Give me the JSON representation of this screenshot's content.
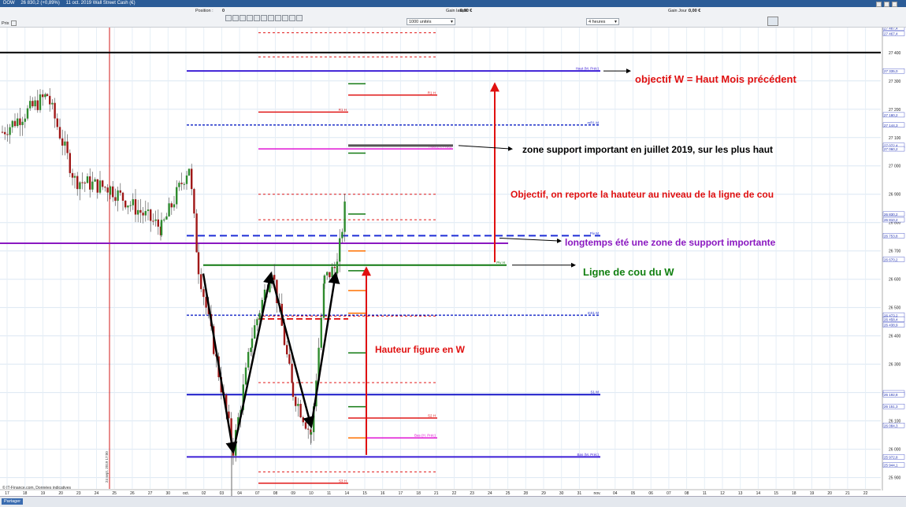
{
  "titlebar": {
    "items": [
      "DOW",
      "26 830,2 (+0,89%)",
      "11 oct. 2019 Wall Street Cash (€)"
    ]
  },
  "toolbar": {
    "position_label": "Position :",
    "position_value": "0",
    "gain_latent_label": "Gain latent :",
    "gain_latent_value": "0,00 €",
    "gain_jour_label": "Gain Jour :",
    "gain_jour_value": "0,00 €",
    "units_select": "1000 unités",
    "interval_select": "4 heures",
    "price_label": "Prix"
  },
  "chart_data": {
    "type": "candlestick",
    "instrument": "DOW - Wall Street Cash (€)",
    "last_price": "26 830,2",
    "change": "+0,89%",
    "x_tick_labels": [
      "17",
      "18",
      "19",
      "20",
      "23",
      "24",
      "25",
      "26",
      "27",
      "30",
      "oct.",
      "02",
      "03",
      "04",
      "07",
      "08",
      "09",
      "10",
      "11",
      "14",
      "15",
      "16",
      "17",
      "18",
      "21",
      "22",
      "23",
      "24",
      "25",
      "28",
      "29",
      "30",
      "31",
      "nov.",
      "04",
      "05",
      "06",
      "07",
      "08",
      "11",
      "12",
      "13",
      "14",
      "15",
      "18",
      "19",
      "20",
      "21",
      "22"
    ],
    "y_tick_labels": [
      "27 400",
      "27 300",
      "27 200",
      "27 100",
      "27 000",
      "26 900",
      "26 800",
      "26 700",
      "26 600",
      "26 500",
      "26 400",
      "26 300",
      "26 200",
      "26 100",
      "26 000",
      "25 900"
    ],
    "y_range": [
      25860,
      27480
    ],
    "price_tags": [
      "27 487,4",
      "27 467,4",
      "27 335,0",
      "27 180,2",
      "27 144,3",
      "27 072,4",
      "27 060,2",
      "26 830,2",
      "26 810,2",
      "26 753,8",
      "26 670,2",
      "26 473,2",
      "26 458,4",
      "26 438,9",
      "26 199,0",
      "26 192,8",
      "26 151,3",
      "26 084,3",
      "25 972,8",
      "25 944,1"
    ],
    "horizontal_lines": [
      {
        "label": "Haut (M. Préc)",
        "value": 27335.0,
        "color": "#3d1fd6",
        "style": "solid"
      },
      {
        "label": "mR1 M",
        "value": 27144.3,
        "color": "#1d2fc9",
        "style": "dotted"
      },
      {
        "label": "Haut (H. Préc)",
        "value": 27060.2,
        "color": "#e016d4",
        "style": "solid"
      },
      {
        "label": "Piv M",
        "value": 26753.8,
        "color": "#1f2fd6",
        "style": "dashed"
      },
      {
        "label": "Piv H",
        "value": 26650.0,
        "color": "#127a12",
        "style": "solid"
      },
      {
        "label": "mS1 M",
        "value": 26473.2,
        "color": "#1d2fc9",
        "style": "dotted"
      },
      {
        "label": "S1 M",
        "value": 26192.8,
        "color": "#1818c8",
        "style": "solid"
      },
      {
        "label": "Bas (M. Préc)",
        "value": 25972.8,
        "color": "#3d1fd6",
        "style": "solid"
      },
      {
        "label": "Bas (H. Préc)",
        "value": 26040.0,
        "color": "#e016d4",
        "style": "solid"
      },
      {
        "label": "R1 H",
        "value": 27190.0,
        "color": "#e01818",
        "style": "solid"
      },
      {
        "label": "R1 H",
        "value": 27250.0,
        "color": "#e01818",
        "style": "solid"
      },
      {
        "label": "S2 H",
        "value": 26110.0,
        "color": "#e01818",
        "style": "solid"
      },
      {
        "label": "S3 H",
        "value": 25880.0,
        "color": "#e01818",
        "style": "solid"
      }
    ],
    "annotations": [
      "objectif W = Haut Mois précédent",
      "zone support important en juillet 2019, sur les plus haut",
      "Objectif, on reporte la hauteur au niveau de la ligne de cou",
      "longtemps été une zone de support importante",
      "Ligne de cou du W",
      "Hauteur figure en W"
    ],
    "vertical_marker_label": "24 sept. 2019 17:00",
    "footer_text": "© IT-Finance.com, Données indicatives"
  },
  "bottombar": {
    "share_label": "Partager"
  },
  "colors": {
    "titlebar": "#2b5c97",
    "up_candle": "#2e8b2e",
    "down_candle": "#a01818",
    "annotation_red": "#e01010",
    "annotation_purple": "#8a18c0",
    "annotation_green": "#128012",
    "annotation_black": "#000000"
  }
}
